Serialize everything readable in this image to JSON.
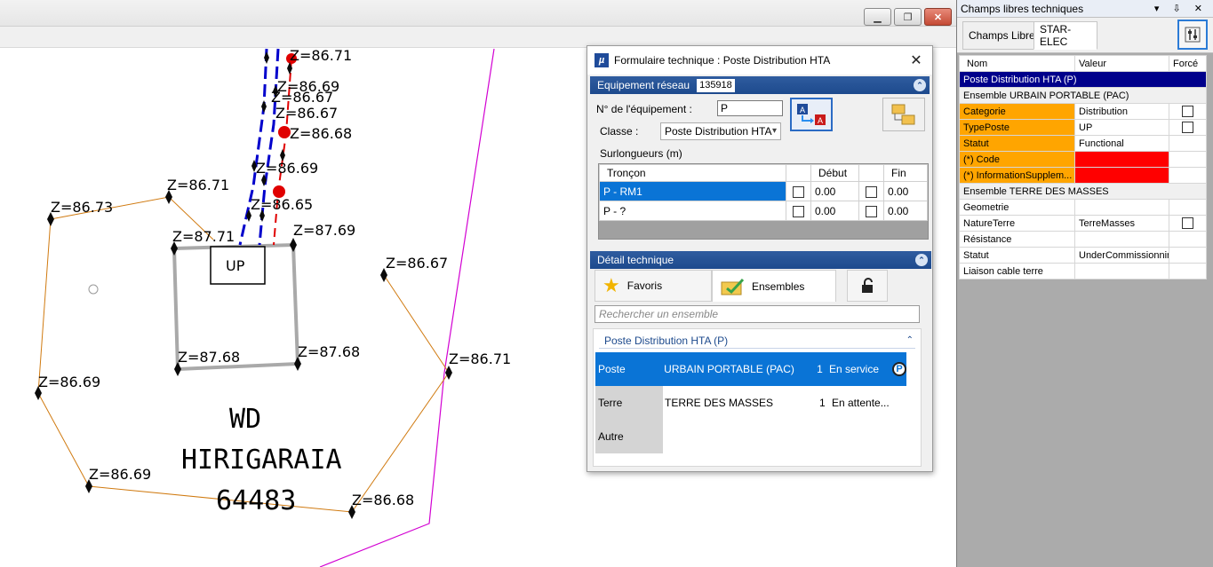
{
  "window": {
    "minimize_glyph": "▁",
    "restore_glyph": "❐",
    "close_glyph": "✕"
  },
  "map": {
    "labels": [
      {
        "text": "Z=86.71"
      },
      {
        "text": "Z=86.69"
      },
      {
        "text": "Z=86.67"
      },
      {
        "text": "Z=86.67"
      },
      {
        "text": "Z=86.68"
      },
      {
        "text": "Z=86.69"
      },
      {
        "text": "Z=86.65"
      },
      {
        "text": "Z=86.73"
      },
      {
        "text": "Z=86.71"
      },
      {
        "text": "Z=87.71"
      },
      {
        "text": "Z=87.69"
      },
      {
        "text": "Z=86.67"
      },
      {
        "text": "Z=87.68"
      },
      {
        "text": "Z=87.68"
      },
      {
        "text": "Z=86.69"
      },
      {
        "text": "Z=86.71"
      },
      {
        "text": "Z=86.69"
      },
      {
        "text": "Z=86.68"
      }
    ],
    "box_label": "UP",
    "title_lines": [
      "WD",
      "HIRIGARAIA",
      "64483"
    ]
  },
  "dialog": {
    "title": "Formulaire technique : Poste Distribution HTA",
    "logo": "µ",
    "close": "✕",
    "equipment_section": "Equipement réseau",
    "equipment_id": "135918",
    "equip_no_label": "N° de l'équipement :",
    "equip_no_value": "P",
    "class_label": "Classe :",
    "class_value": "Poste Distribution HTA",
    "surlongueurs_label": "Surlongueurs (m)",
    "grid": {
      "headers": [
        "Tronçon",
        "Début",
        "Fin"
      ],
      "rows": [
        {
          "troncon": "P - RM1",
          "debut": "0.00",
          "fin": "0.00"
        },
        {
          "troncon": "P - ?",
          "debut": "0.00",
          "fin": "0.00"
        }
      ]
    },
    "detail_section": "Détail technique",
    "tabs": {
      "favoris": "Favoris",
      "ensembles": "Ensembles"
    },
    "search_placeholder": "Rechercher un ensemble",
    "ensemble_group": "Poste Distribution HTA (P)",
    "ensembles": [
      {
        "label": "Poste",
        "name": "URBAIN PORTABLE (PAC)",
        "count": "1",
        "state": "En service",
        "badge": "P"
      },
      {
        "label": "Terre",
        "name": "TERRE DES MASSES",
        "count": "1",
        "state": "En attente..."
      },
      {
        "label": "Autre",
        "name": "",
        "count": "",
        "state": ""
      }
    ]
  },
  "rpanel": {
    "title": "Champs libres techniques",
    "title_controls": "▾ ⇩ ✕",
    "tabs": [
      "Champs Libres",
      "STAR-ELEC"
    ],
    "columns": [
      "Nom",
      "Valeur",
      "Forcé"
    ],
    "group_title": "Poste Distribution HTA (P)",
    "subgroup1": "Ensemble URBAIN PORTABLE (PAC)",
    "rows1": [
      {
        "nom": "Categorie",
        "valeur": "Distribution"
      },
      {
        "nom": "TypePoste",
        "valeur": "UP"
      },
      {
        "nom": "Statut",
        "valeur": "Functional"
      },
      {
        "nom": "(*)  Code",
        "valeur": ""
      },
      {
        "nom": "(*)  InformationSupplem...",
        "valeur": ""
      }
    ],
    "subgroup2": "Ensemble TERRE DES MASSES",
    "rows2": [
      {
        "nom": "Geometrie",
        "valeur": ""
      },
      {
        "nom": "NatureTerre",
        "valeur": "TerreMasses"
      },
      {
        "nom": "Résistance",
        "valeur": ""
      },
      {
        "nom": "Statut",
        "valeur": "UnderCommissionning"
      },
      {
        "nom": "Liaison cable terre",
        "valeur": ""
      }
    ]
  }
}
